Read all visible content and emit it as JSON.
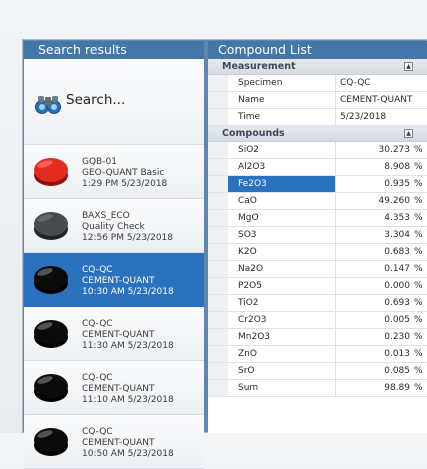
{
  "colors": {
    "header": "#4477a7",
    "selection": "#2a72be"
  },
  "left": {
    "title": "Search results",
    "search_label": "Search...",
    "search_icon": "binoculars-icon",
    "items": [
      {
        "line1": "GQB-01",
        "line2": "GEO-QUANT Basic",
        "line3": "1:29 PM 5/23/2018",
        "icon": "red-sample-puck-icon"
      },
      {
        "line1": "BAXS_ECO",
        "line2": "Quality Check",
        "line3": "12:56 PM 5/23/2018",
        "icon": "gray-sample-puck-icon"
      },
      {
        "line1": "CQ-QC",
        "line2": "CEMENT-QUANT",
        "line3": "10:30 AM 5/23/2018",
        "icon": "black-sample-puck-icon",
        "selected": true
      },
      {
        "line1": "CQ-QC",
        "line2": "CEMENT-QUANT",
        "line3": "11:30 AM 5/23/2018",
        "icon": "black-sample-puck-icon"
      },
      {
        "line1": "CQ-QC",
        "line2": "CEMENT-QUANT",
        "line3": "11:10 AM 5/23/2018",
        "icon": "black-sample-puck-icon"
      },
      {
        "line1": "CQ-QC",
        "line2": "CEMENT-QUANT",
        "line3": "10:50 AM 5/23/2018",
        "icon": "black-sample-puck-icon"
      }
    ]
  },
  "right": {
    "title": "Compound List",
    "measurement": {
      "label": "Measurement",
      "collapse_icon": "collapse-icon",
      "rows": [
        {
          "key": "Specimen",
          "value": "CQ-QC"
        },
        {
          "key": "Name",
          "value": "CEMENT-QUANT"
        },
        {
          "key": "Time",
          "value": "5/23/2018"
        }
      ]
    },
    "compounds": {
      "label": "Compounds",
      "collapse_icon": "collapse-icon",
      "rows": [
        {
          "key": "SiO2",
          "value": "30.273",
          "unit": "%"
        },
        {
          "key": "Al2O3",
          "value": "8.908",
          "unit": "%"
        },
        {
          "key": "Fe2O3",
          "value": "0.935",
          "unit": "%",
          "selected": true
        },
        {
          "key": "CaO",
          "value": "49.260",
          "unit": "%"
        },
        {
          "key": "MgO",
          "value": "4.353",
          "unit": "%"
        },
        {
          "key": "SO3",
          "value": "3.304",
          "unit": "%"
        },
        {
          "key": "K2O",
          "value": "0.683",
          "unit": "%"
        },
        {
          "key": "Na2O",
          "value": "0.147",
          "unit": "%"
        },
        {
          "key": "P2O5",
          "value": "0.000",
          "unit": "%"
        },
        {
          "key": "TiO2",
          "value": "0.693",
          "unit": "%"
        },
        {
          "key": "Cr2O3",
          "value": "0.005",
          "unit": "%"
        },
        {
          "key": "Mn2O3",
          "value": "0.230",
          "unit": "%"
        },
        {
          "key": "ZnO",
          "value": "0.013",
          "unit": "%"
        },
        {
          "key": "SrO",
          "value": "0.085",
          "unit": "%"
        },
        {
          "key": "Sum",
          "value": "98.89",
          "unit": "%"
        }
      ]
    }
  }
}
